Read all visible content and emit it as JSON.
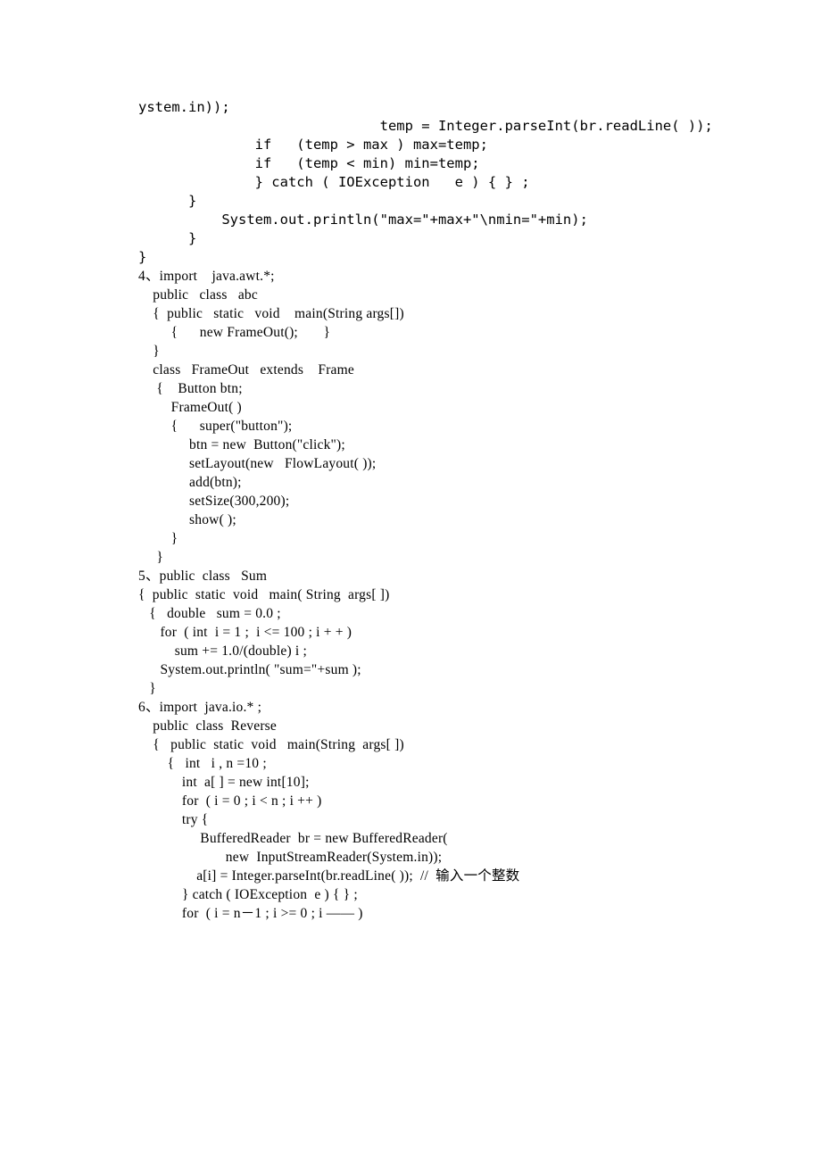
{
  "lines": [
    {
      "cls": "mono",
      "text": "ystem.in));"
    },
    {
      "cls": "mono",
      "text": "                             temp = Integer.parseInt(br.readLine( ));"
    },
    {
      "cls": "mono",
      "text": "              if   (temp > max ) max=temp;"
    },
    {
      "cls": "mono",
      "text": "              if   (temp < min) min=temp;"
    },
    {
      "cls": "mono",
      "text": "              } catch ( IOException   e ) { } ;"
    },
    {
      "cls": "mono",
      "text": "      }"
    },
    {
      "cls": "mono",
      "text": "          System.out.println(\"max=\"+max+\"\\nmin=\"+min);"
    },
    {
      "cls": "mono",
      "text": "      }"
    },
    {
      "cls": "mono",
      "text": "}"
    },
    {
      "cls": "serif",
      "text": "4、import    java.awt.*;"
    },
    {
      "cls": "serif",
      "text": "    public   class   abc"
    },
    {
      "cls": "serif",
      "text": "    {  public   static   void    main(String args[])"
    },
    {
      "cls": "serif",
      "text": "         {      new FrameOut();       }"
    },
    {
      "cls": "serif",
      "text": "    }"
    },
    {
      "cls": "serif",
      "text": "    class   FrameOut   extends    Frame"
    },
    {
      "cls": "serif",
      "text": "     {    Button btn;"
    },
    {
      "cls": "serif",
      "text": "         FrameOut( )"
    },
    {
      "cls": "serif",
      "text": "         {      super(\"button\");"
    },
    {
      "cls": "serif",
      "text": "              btn = new  Button(\"click\");"
    },
    {
      "cls": "serif",
      "text": "              setLayout(new   FlowLayout( ));"
    },
    {
      "cls": "serif",
      "text": "              add(btn);"
    },
    {
      "cls": "serif",
      "text": "              setSize(300,200);"
    },
    {
      "cls": "serif",
      "text": "              show( );"
    },
    {
      "cls": "serif",
      "text": "         }"
    },
    {
      "cls": "serif",
      "text": "     }"
    },
    {
      "cls": "serif",
      "text": "5、public  class   Sum"
    },
    {
      "cls": "serif",
      "text": "{  public  static  void   main( String  args[ ])"
    },
    {
      "cls": "serif",
      "text": "   {   double   sum = 0.0 ;"
    },
    {
      "cls": "serif",
      "text": "      for  ( int  i = 1 ;  i <= 100 ; i + + )"
    },
    {
      "cls": "serif",
      "text": "          sum += 1.0/(double) i ;"
    },
    {
      "cls": "serif",
      "text": "      System.out.println( \"sum=\"+sum );"
    },
    {
      "cls": "serif",
      "text": "   }"
    },
    {
      "cls": "serif",
      "text": "6、import  java.io.* ;"
    },
    {
      "cls": "serif",
      "text": "    public  class  Reverse"
    },
    {
      "cls": "serif",
      "text": "    {   public  static  void   main(String  args[ ])"
    },
    {
      "cls": "serif",
      "text": "        {   int   i , n =10 ;"
    },
    {
      "cls": "serif",
      "text": "            int  a[ ] = new int[10];"
    },
    {
      "cls": "serif",
      "text": "            for  ( i = 0 ; i < n ; i ++ )"
    },
    {
      "cls": "serif",
      "text": "            try {"
    },
    {
      "cls": "serif",
      "text": "                 BufferedReader  br = new BufferedReader("
    },
    {
      "cls": "serif",
      "text": "                        new  InputStreamReader(System.in));"
    },
    {
      "cls": "serif",
      "text": "                a[i] = Integer.parseInt(br.readLine( ));  //  输入一个整数"
    },
    {
      "cls": "serif",
      "text": "            } catch ( IOException  e ) { } ;"
    },
    {
      "cls": "serif",
      "text": "            for  ( i = n－1 ; i >= 0 ; i ―― )"
    }
  ]
}
